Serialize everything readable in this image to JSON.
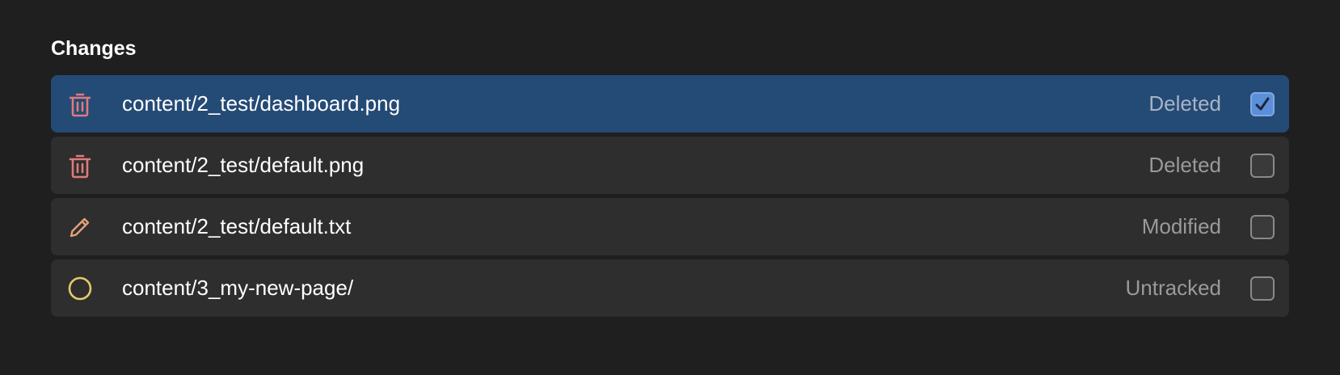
{
  "section": {
    "title": "Changes"
  },
  "rows": [
    {
      "path": "content/2_test/dashboard.png",
      "status": "Deleted",
      "icon": "trash-icon",
      "checked": true,
      "selected": true
    },
    {
      "path": "content/2_test/default.png",
      "status": "Deleted",
      "icon": "trash-icon",
      "checked": false,
      "selected": false
    },
    {
      "path": "content/2_test/default.txt",
      "status": "Modified",
      "icon": "pencil-icon",
      "checked": false,
      "selected": false
    },
    {
      "path": "content/3_my-new-page/",
      "status": "Untracked",
      "icon": "circle-icon",
      "checked": false,
      "selected": false
    }
  ],
  "colors": {
    "background": "#1f1f1f",
    "row": "#2e2e2e",
    "row_selected": "#244a76",
    "deleted_icon": "#e07a7a",
    "modified_icon": "#e3a07a",
    "untracked_icon": "#e8c86a",
    "checkbox_checked": "#5b8fd9"
  }
}
